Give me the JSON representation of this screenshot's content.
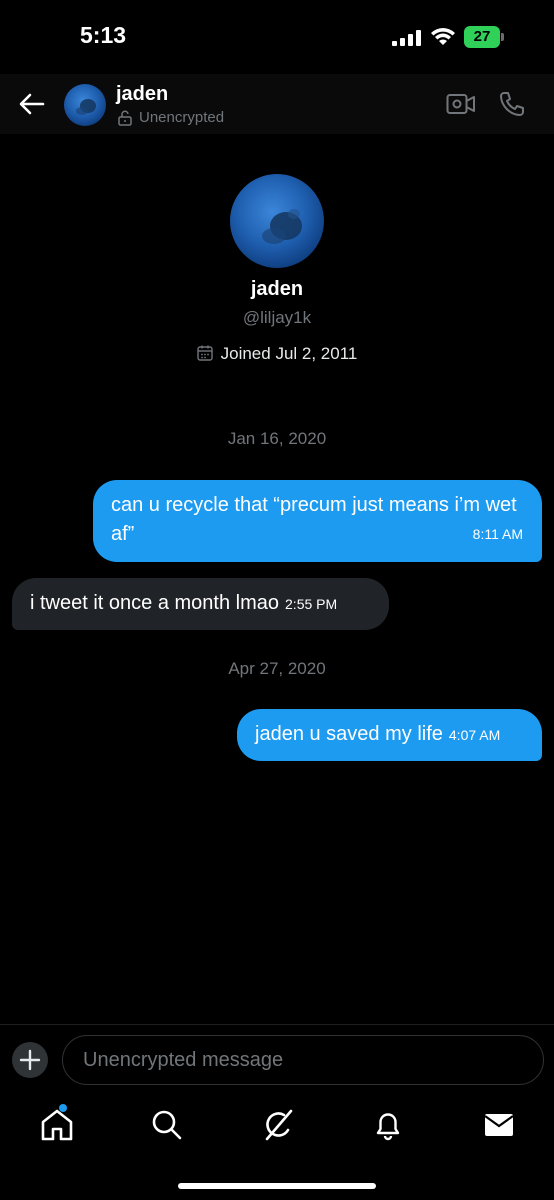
{
  "status_bar": {
    "time": "5:13",
    "battery": "27"
  },
  "header": {
    "name": "jaden",
    "encryption_status": "Unencrypted"
  },
  "profile": {
    "name": "jaden",
    "handle": "@liljay1k",
    "joined": "Joined Jul 2, 2011"
  },
  "messages": [
    {
      "date": "Jan 16, 2020"
    },
    {
      "direction": "outgoing",
      "text": "can u recycle that “precum just means i’m wet af”",
      "time": "8:11 AM"
    },
    {
      "direction": "incoming",
      "text": "i tweet it once a month lmao",
      "time": "2:55 PM"
    },
    {
      "date": "Apr 27, 2020"
    },
    {
      "direction": "outgoing",
      "text": "jaden u saved my life",
      "time": "4:07 AM"
    }
  ],
  "composer": {
    "placeholder": "Unencrypted message"
  },
  "nav": {
    "items": [
      "home-icon",
      "search-icon",
      "grok-icon",
      "bell-icon",
      "mail-icon"
    ]
  },
  "colors": {
    "accent": "#1d9bf0",
    "incoming_bubble": "#202327",
    "background": "#000000",
    "battery": "#30d158"
  }
}
